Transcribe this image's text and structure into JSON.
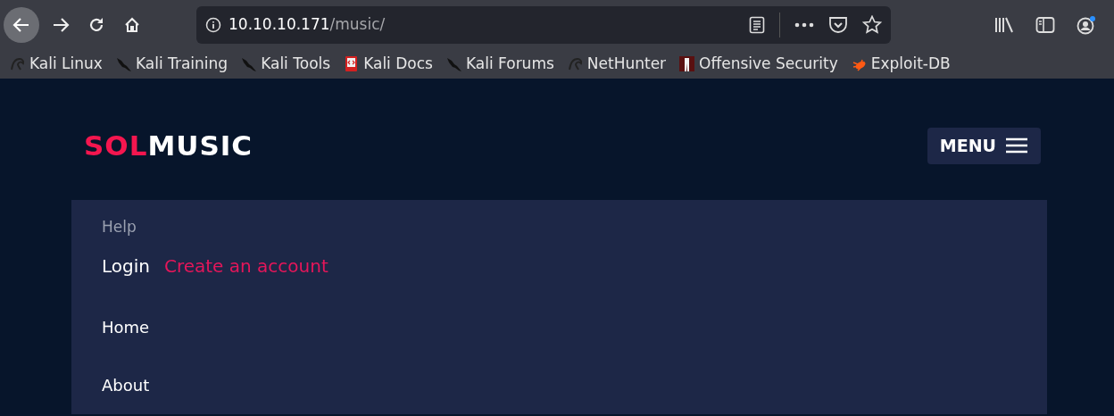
{
  "browser": {
    "url": {
      "host": "10.10.10.171",
      "path": "/music/"
    },
    "bookmarks": [
      {
        "label": "Kali Linux",
        "kind": "dragon"
      },
      {
        "label": "Kali Training",
        "kind": "knife"
      },
      {
        "label": "Kali Tools",
        "kind": "knife"
      },
      {
        "label": "Kali Docs",
        "kind": "book"
      },
      {
        "label": "Kali Forums",
        "kind": "knife"
      },
      {
        "label": "NetHunter",
        "kind": "dragon"
      },
      {
        "label": "Offensive Security",
        "kind": "figure"
      },
      {
        "label": "Exploit-DB",
        "kind": "bug"
      }
    ]
  },
  "site": {
    "logo": {
      "accent": "SOL",
      "rest": "MUSIC"
    },
    "menu_button": "MENU",
    "menu": {
      "help": "Help",
      "login": "Login",
      "register": "Create an account",
      "items": [
        "Home",
        "About"
      ]
    }
  }
}
